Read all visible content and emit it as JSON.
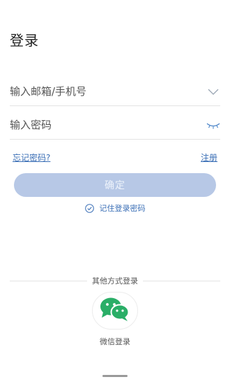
{
  "header": {
    "title": "登录"
  },
  "form": {
    "account_placeholder": "输入邮箱/手机号",
    "password_placeholder": "输入密码",
    "account_icon": "chevron-down-icon",
    "password_icon": "eye-closed-icon"
  },
  "links": {
    "forgot": "忘记密码?",
    "register": "注册"
  },
  "actions": {
    "confirm": "确定"
  },
  "remember": {
    "label": "记住登录密码",
    "checked": true
  },
  "other_login": {
    "title": "其他方式登录",
    "wechat_label": "微信登录",
    "wechat_icon": "wechat-icon"
  },
  "colors": {
    "accent": "#3b6fb6",
    "button_bg": "#b7c8e6",
    "wechat_green": "#2aae67"
  }
}
